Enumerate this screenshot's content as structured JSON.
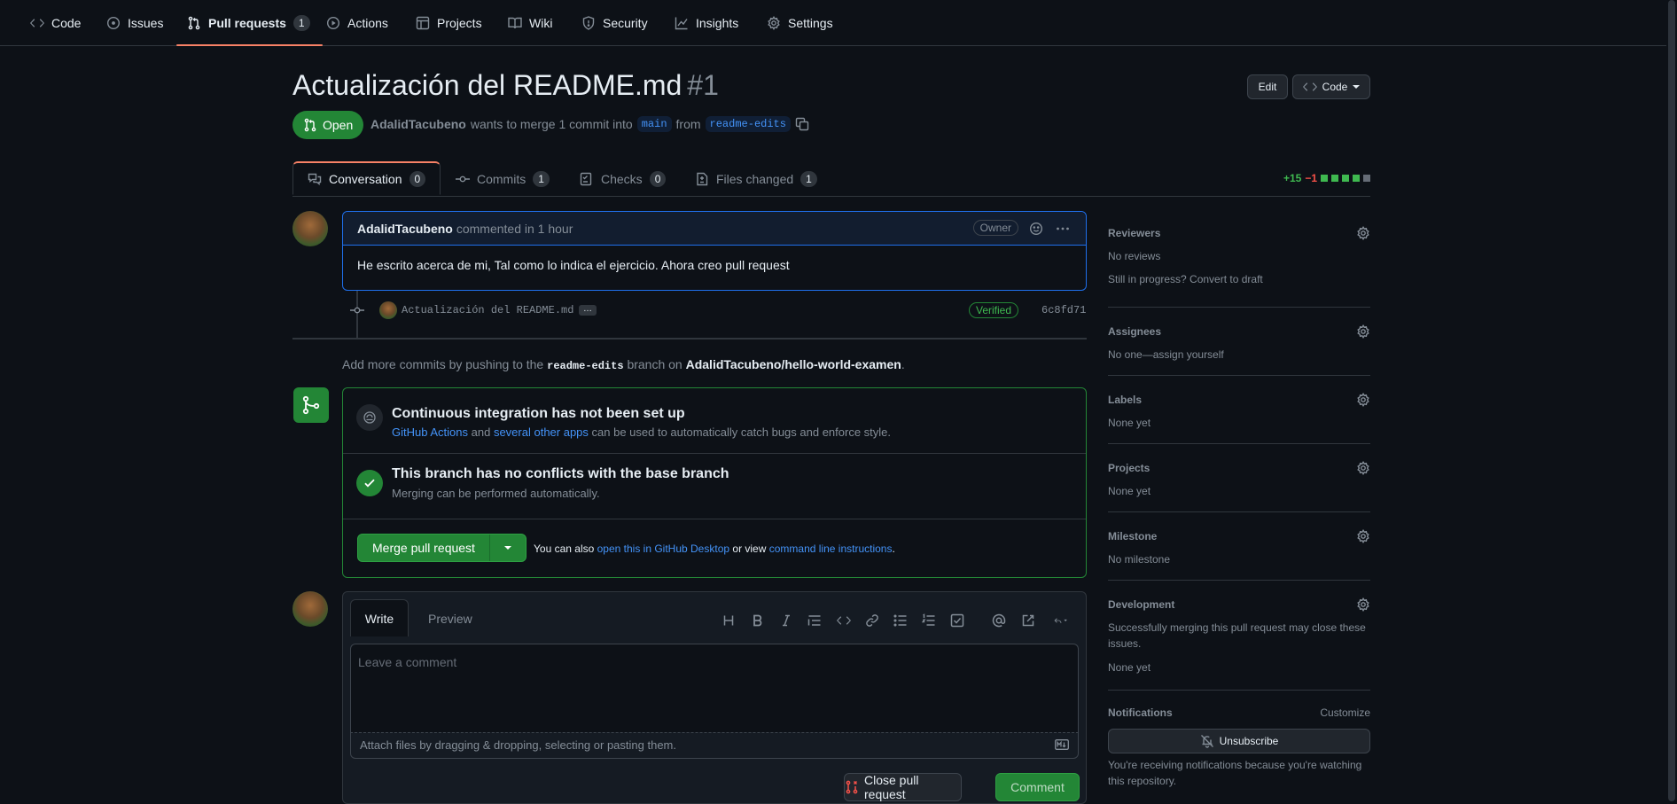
{
  "nav": {
    "items": [
      {
        "label": "Code",
        "icon": "code-icon"
      },
      {
        "label": "Issues",
        "icon": "issue-icon"
      },
      {
        "label": "Pull requests",
        "icon": "pull-request-icon",
        "count": "1"
      },
      {
        "label": "Actions",
        "icon": "play-icon"
      },
      {
        "label": "Projects",
        "icon": "table-icon"
      },
      {
        "label": "Wiki",
        "icon": "book-icon"
      },
      {
        "label": "Security",
        "icon": "shield-icon"
      },
      {
        "label": "Insights",
        "icon": "graph-icon"
      },
      {
        "label": "Settings",
        "icon": "gear-icon"
      }
    ]
  },
  "pr": {
    "title": "Actualización del README.md",
    "number": "#1",
    "edit_label": "Edit",
    "code_label": "Code",
    "state": "Open",
    "author": "AdalidTacubeno",
    "meta_text_1": "wants to merge 1 commit into",
    "base_branch": "main",
    "meta_from": "from",
    "head_branch": "readme-edits"
  },
  "tabs": [
    {
      "label": "Conversation",
      "count": "0"
    },
    {
      "label": "Commits",
      "count": "1"
    },
    {
      "label": "Checks",
      "count": "0"
    },
    {
      "label": "Files changed",
      "count": "1"
    }
  ],
  "diffstat": {
    "additions": "+15",
    "deletions": "−1"
  },
  "comment": {
    "author": "AdalidTacubeno",
    "time": "commented in 1 hour",
    "badge": "Owner",
    "body": "He escrito acerca de mi, Tal como lo indica el ejercicio. Ahora creo pull request"
  },
  "commit": {
    "message": "Actualización del README.md",
    "ellipsis": "…",
    "verified": "Verified",
    "sha": "6c8fd71"
  },
  "push_hint": {
    "text_1": "Add more commits by pushing to the",
    "branch": "readme-edits",
    "text_2": "branch on",
    "repo": "AdalidTacubeno/hello-world-examen",
    "text_3": "."
  },
  "merge": {
    "ci_title": "Continuous integration has not been set up",
    "ci_link_1": "GitHub Actions",
    "ci_and": "and",
    "ci_link_2": "several other apps",
    "ci_text": "can be used to automatically catch bugs and enforce style.",
    "conflict_title": "This branch has no conflicts with the base branch",
    "conflict_sub": "Merging can be performed automatically.",
    "button": "Merge pull request",
    "also_1": "You can also",
    "also_link_1": "open this in GitHub Desktop",
    "also_2": "or view",
    "also_link_2": "command line instructions",
    "also_3": "."
  },
  "composer": {
    "write_tab": "Write",
    "preview_tab": "Preview",
    "placeholder": "Leave a comment",
    "attach": "Attach files by dragging & dropping, selecting or pasting them.",
    "close_button": "Close pull request",
    "comment_button": "Comment",
    "toolbar_icons": [
      "heading-icon",
      "bold-icon",
      "italic-icon",
      "quote-icon",
      "code-icon",
      "link-icon",
      "unordered-list-icon",
      "ordered-list-icon",
      "tasklist-icon",
      "mention-icon",
      "cross-reference-icon",
      "reply-icon"
    ]
  },
  "sidebar": {
    "reviewers_title": "Reviewers",
    "reviewers_value": "No reviews",
    "reviewers_hint": "Still in progress? Convert to draft",
    "assignees_title": "Assignees",
    "assignees_value": "No one—assign yourself",
    "labels_title": "Labels",
    "labels_value": "None yet",
    "projects_title": "Projects",
    "projects_value": "None yet",
    "milestone_title": "Milestone",
    "milestone_value": "No milestone",
    "development_title": "Development",
    "development_text_1": "Successfully merging this pull request may close these",
    "development_text_2": "issues.",
    "development_value": "None yet",
    "notifications_title": "Notifications",
    "notifications_customize": "Customize",
    "unsubscribe": "Unsubscribe",
    "notifications_text_1": "You're receiving notifications because you're watching",
    "notifications_text_2": "this repository."
  },
  "colors": {
    "background": "#0d1117",
    "accent_green": "#238636",
    "link_blue": "#4493f8",
    "tab_underline": "#f78166"
  }
}
